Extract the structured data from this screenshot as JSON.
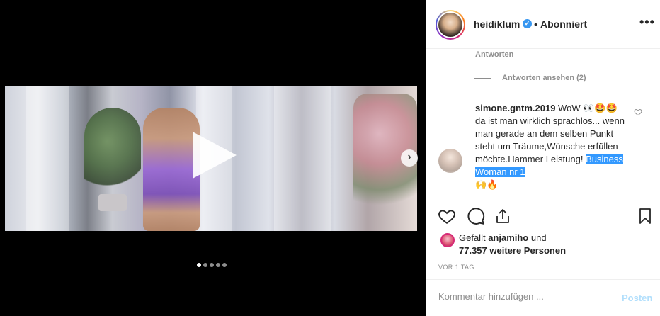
{
  "post": {
    "username": "heidiklum",
    "separator": "•",
    "follow_status": "Abonniert",
    "more_icon": "•••",
    "verified_icon": "✓"
  },
  "thread": {
    "reply_label": "Antworten",
    "view_replies_label": "Antworten ansehen (2)"
  },
  "comment": {
    "username": "simone.gntm.2019",
    "text": " WoW 👀🤩🤩da ist man wirklich sprachlos... wenn man gerade an dem selben Punkt steht um Träume,Wünsche erfüllen möchte.Hammer Leistung! ",
    "highlighted_text": "Business Woman nr 1",
    "trailing_emoji": "🙌🔥"
  },
  "likes": {
    "prefix": "Gefällt ",
    "user": "anjamiho",
    "middle": " und ",
    "count": "77.357 weitere Personen"
  },
  "timestamp": "VOR 1 TAG",
  "composer": {
    "placeholder": "Kommentar hinzufügen ...",
    "post_label": "Posten"
  },
  "carousel": {
    "slide_count": 5,
    "active_index": 0,
    "next_icon": "›"
  },
  "colors": {
    "accent": "#3897f0",
    "post_disabled": "#b2dffc",
    "muted": "#8e8e8e",
    "selection": "#3399ff"
  }
}
